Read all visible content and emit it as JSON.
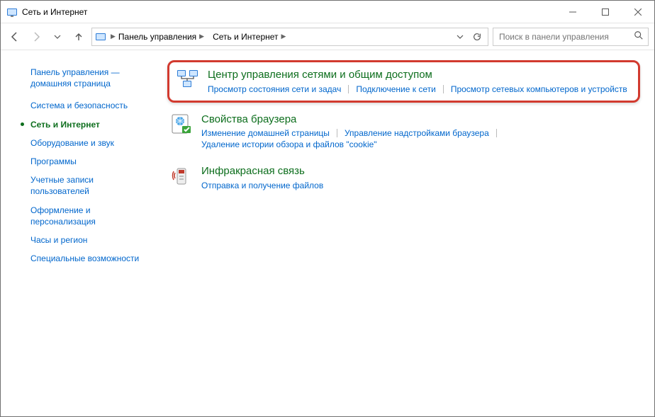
{
  "window": {
    "title": "Сеть и Интернет"
  },
  "breadcrumbs": {
    "items": [
      {
        "label": "Панель управления"
      },
      {
        "label": "Сеть и Интернет"
      }
    ]
  },
  "search": {
    "placeholder": "Поиск в панели управления"
  },
  "sidebar": {
    "home": "Панель управления — домашняя страница",
    "items": [
      {
        "label": "Система и безопасность",
        "active": false
      },
      {
        "label": "Сеть и Интернет",
        "active": true
      },
      {
        "label": "Оборудование и звук",
        "active": false
      },
      {
        "label": "Программы",
        "active": false
      },
      {
        "label": "Учетные записи пользователей",
        "active": false
      },
      {
        "label": "Оформление и персонализация",
        "active": false
      },
      {
        "label": "Часы и регион",
        "active": false
      },
      {
        "label": "Специальные возможности",
        "active": false
      }
    ]
  },
  "categories": [
    {
      "title": "Центр управления сетями и общим доступом",
      "highlighted": true,
      "links": [
        "Просмотр состояния сети и задач",
        "Подключение к сети",
        "Просмотр сетевых компьютеров и устройств"
      ]
    },
    {
      "title": "Свойства браузера",
      "highlighted": false,
      "links": [
        "Изменение домашней страницы",
        "Управление надстройками браузера",
        "Удаление истории обзора и файлов \"cookie\""
      ]
    },
    {
      "title": "Инфракрасная связь",
      "highlighted": false,
      "links": [
        "Отправка и получение файлов"
      ]
    }
  ]
}
